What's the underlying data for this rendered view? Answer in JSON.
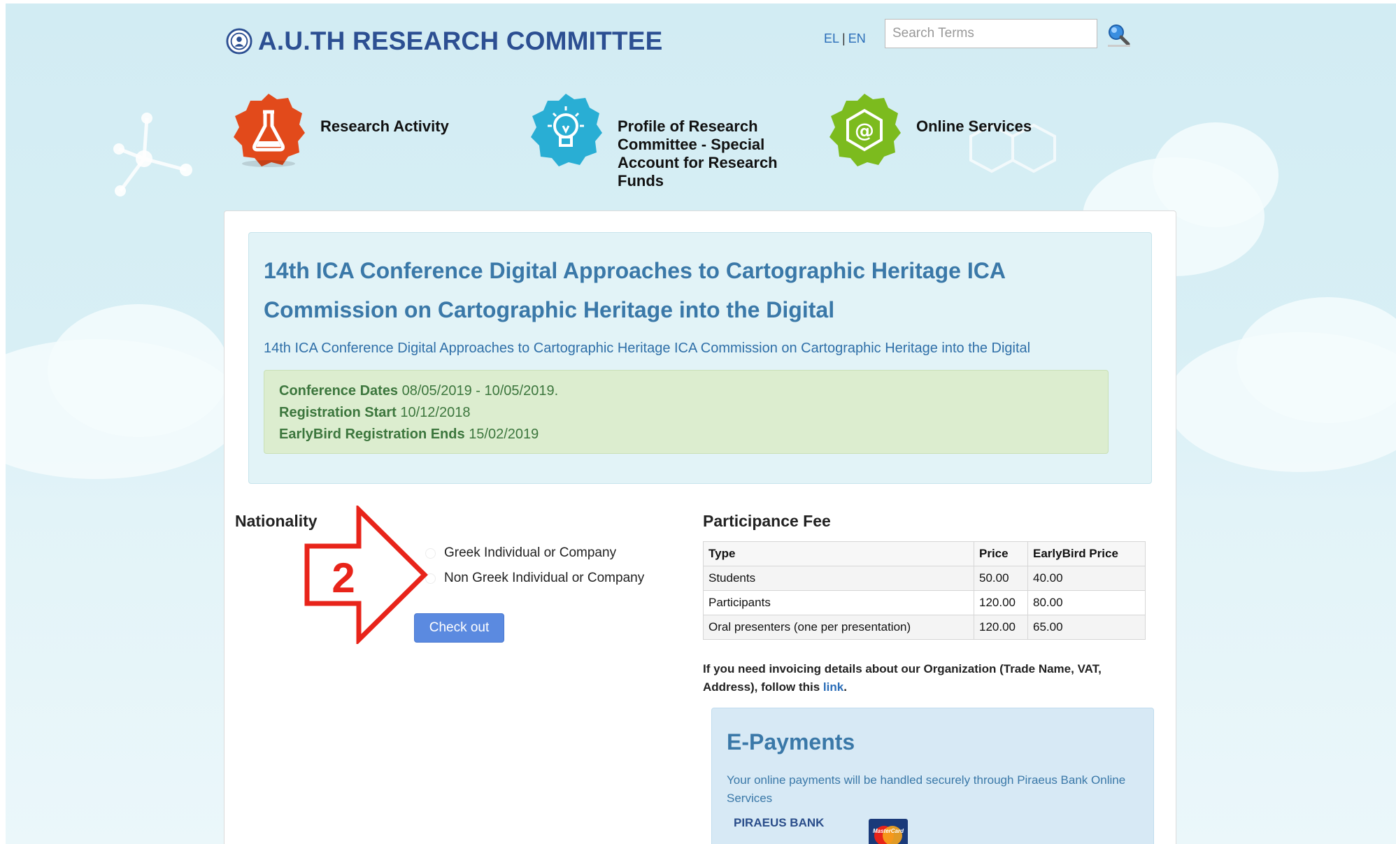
{
  "header": {
    "logo_text": "A.U.TH RESEARCH COMMITTEE",
    "lang_el": "EL",
    "lang_sep": "|",
    "lang_en": "EN",
    "search_placeholder": "Search Terms",
    "search_icon": "magnifier-icon"
  },
  "nav": {
    "research": {
      "label": "Research Activity",
      "icon": "flask-icon",
      "color": "#e24a1b"
    },
    "profile": {
      "label": "Profile of Research Committee - Special Account for Research Funds",
      "icon": "lightbulb-icon",
      "color": "#29aed4"
    },
    "online": {
      "label": "Online Services",
      "icon": "at-sign-icon",
      "color": "#7cbb1e"
    }
  },
  "conference": {
    "title": "14th ICA Conference Digital Approaches to Cartographic Heritage ICA Commission on Cartographic Heritage into the Digital",
    "subtitle": "14th ICA Conference Digital Approaches to Cartographic Heritage ICA Commission on Cartographic Heritage into the Digital",
    "dates": [
      {
        "label": "Conference Dates",
        "value": "08/05/2019 - 10/05/2019."
      },
      {
        "label": "Registration Start",
        "value": "10/12/2018"
      },
      {
        "label": "EarlyBird Registration Ends",
        "value": "15/02/2019"
      }
    ]
  },
  "nationality": {
    "label": "Nationality",
    "options": [
      "Greek Individual or Company",
      "Non Greek Individual or Company"
    ],
    "checkout_label": "Check out",
    "annotation_number": "2"
  },
  "fee": {
    "title": "Participance Fee",
    "columns": [
      "Type",
      "Price",
      "EarlyBird Price"
    ],
    "rows": [
      {
        "type": "Students",
        "price": "50.00",
        "earlybird": "40.00"
      },
      {
        "type": "Participants",
        "price": "120.00",
        "earlybird": "80.00"
      },
      {
        "type": "Oral presenters (one per presentation)",
        "price": "120.00",
        "earlybird": "65.00"
      }
    ],
    "invoice_text": "If you need invoicing details about our Organization (Trade Name, VAT, Address), follow this",
    "invoice_link": "link",
    "invoice_end": "."
  },
  "epayments": {
    "title": "E-Payments",
    "text": "Your online payments will be handled securely through Piraeus Bank Online Services",
    "bank": "PIRAEUS BANK",
    "card_icon": "mastercard-icon",
    "card_text": "MasterCard"
  },
  "colors": {
    "accent": "#3a78a8",
    "annotation_red": "#e8241a",
    "checkout_blue": "#5b8ae0"
  }
}
